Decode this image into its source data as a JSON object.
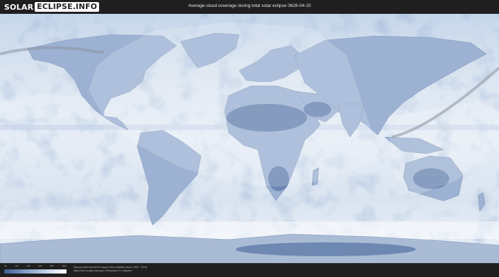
{
  "header": {
    "logo_part1": "SOLAR",
    "logo_part2": "ECLIPSE.INFO",
    "title": "Average cloud coverage during total solar eclipse 0628-04-10"
  },
  "legend": {
    "ticks": [
      "0%",
      "20%",
      "40%",
      "60%",
      "80%",
      "100%"
    ],
    "gradient_colors": [
      "#3e5d91",
      "#7f9cc5",
      "#c2d3ea",
      "#ffffff"
    ]
  },
  "footer": {
    "credit_line1": "Data provided by NASA's Aqua & Terra satellite (Years: 2000 - 2019)",
    "credit_line2": "https://neo.sci.gsfc.nasa.gov | Resolution: 0.1 degrees"
  },
  "map": {
    "projection": "equirectangular",
    "colors": {
      "ocean_cloud": "#dbe5f1",
      "land_clear": "#6d89b5",
      "visibility_overlay": "#ffffff",
      "eclipse_path": "#8a94a0"
    }
  }
}
